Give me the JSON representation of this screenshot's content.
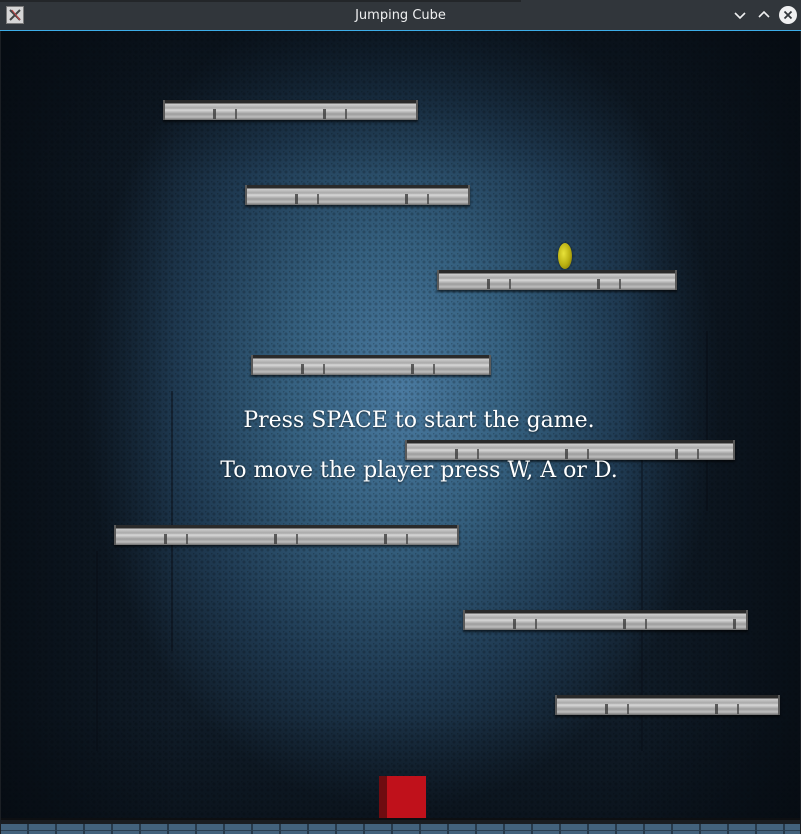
{
  "window": {
    "title": "Jumping Cube",
    "buttons": {
      "minimize_icon": "chevron-down-icon",
      "maximize_icon": "chevron-up-icon",
      "close_icon": "close-icon"
    }
  },
  "game": {
    "instructions": {
      "start": "Press SPACE to start the game.",
      "controls": "To move the player press W, A or D."
    },
    "platform_count": 8,
    "coin_count": 1,
    "colors": {
      "player": "#c0111b",
      "coin": "#c8c020",
      "background": "#35607f",
      "platform": "#bdbdbd"
    }
  }
}
